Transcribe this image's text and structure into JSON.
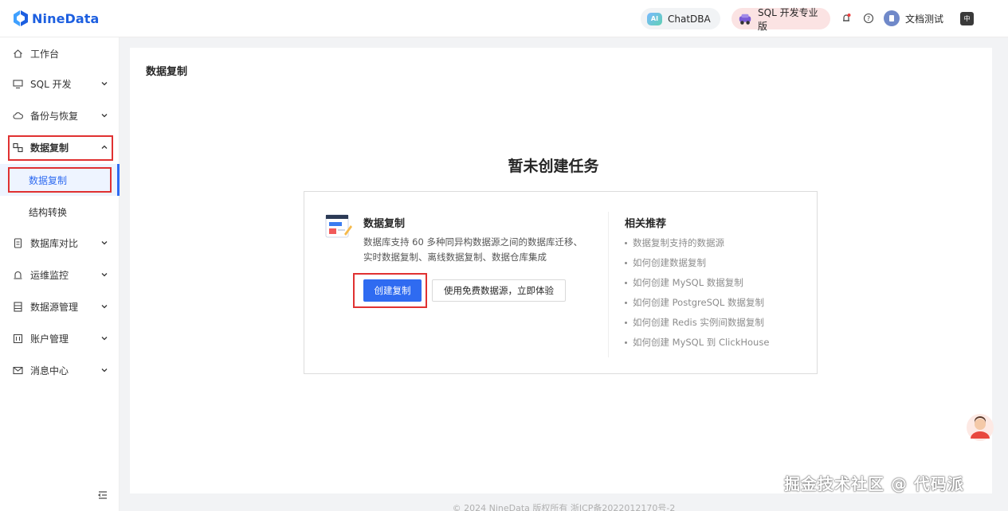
{
  "header": {
    "logo_text": "NineData",
    "chatdba_label": "ChatDBA",
    "chatdba_badge": "AI",
    "sql_pro_label": "SQL 开发专业版",
    "user_name": "文档测试",
    "lang_icon": "中"
  },
  "sidebar": {
    "items": [
      {
        "label": "工作台",
        "icon": "home-icon"
      },
      {
        "label": "SQL 开发",
        "icon": "monitor-icon"
      },
      {
        "label": "备份与恢复",
        "icon": "cloud-icon"
      },
      {
        "label": "数据复制",
        "icon": "replicate-icon"
      },
      {
        "label": "数据库对比",
        "icon": "compare-icon"
      },
      {
        "label": "运维监控",
        "icon": "alarm-icon"
      },
      {
        "label": "数据源管理",
        "icon": "datasource-icon"
      },
      {
        "label": "账户管理",
        "icon": "account-icon"
      },
      {
        "label": "消息中心",
        "icon": "mail-icon"
      }
    ],
    "sub_items": [
      {
        "label": "数据复制",
        "active": true
      },
      {
        "label": "结构转换",
        "active": false
      }
    ]
  },
  "main": {
    "page_title": "数据复制",
    "empty_title": "暂未创建任务",
    "card": {
      "heading": "数据复制",
      "description": "数据库支持 60 多种同异构数据源之间的数据库迁移、实时数据复制、离线数据复制、数据仓库集成",
      "create_button": "创建复制",
      "trial_button": "使用免费数据源，立即体验"
    },
    "recommend": {
      "heading": "相关推荐",
      "links": [
        "数据复制支持的数据源",
        "如何创建数据复制",
        "如何创建 MySQL 数据复制",
        "如何创建 PostgreSQL 数据复制",
        "如何创建 Redis 实例间数据复制",
        "如何创建 MySQL 到 ClickHouse"
      ]
    }
  },
  "footer": "© 2024 NineData 版权所有 浙ICP备2022012170号-2",
  "watermark": "掘金技术社区 @ 代码派",
  "colors": {
    "primary": "#2f6bf1",
    "highlight": "#e03131",
    "brand": "#1d5fe0"
  }
}
